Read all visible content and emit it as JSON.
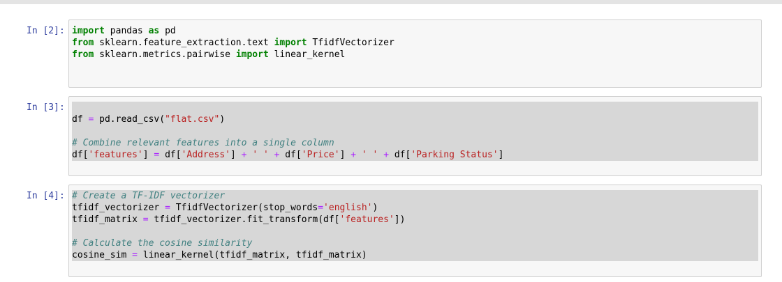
{
  "cells": [
    {
      "prompt": "In [2]:",
      "lines": [
        [
          [
            "kw",
            "import"
          ],
          [
            "t",
            " pandas "
          ],
          [
            "kw",
            "as"
          ],
          [
            "t",
            " pd"
          ]
        ],
        [
          [
            "kw",
            "from"
          ],
          [
            "t",
            " sklearn.feature_extraction.text "
          ],
          [
            "kw",
            "import"
          ],
          [
            "t",
            " TfidfVectorizer"
          ]
        ],
        [
          [
            "kw",
            "from"
          ],
          [
            "t",
            " sklearn.metrics.pairwise "
          ],
          [
            "kw",
            "import"
          ],
          [
            "t",
            " linear_kernel"
          ]
        ]
      ]
    },
    {
      "prompt": "In [3]:",
      "lines": [
        [
          [
            "t",
            "df "
          ],
          [
            "op",
            "="
          ],
          [
            "t",
            " pd.read_csv("
          ],
          [
            "str",
            "\"flat.csv\""
          ],
          [
            "t",
            ")"
          ]
        ],
        [],
        [
          [
            "cm",
            "# Combine relevant features into a single column"
          ]
        ],
        [
          [
            "t",
            "df["
          ],
          [
            "str",
            "'features'"
          ],
          [
            "t",
            "] "
          ],
          [
            "op",
            "="
          ],
          [
            "t",
            " df["
          ],
          [
            "str",
            "'Address'"
          ],
          [
            "t",
            "] "
          ],
          [
            "op",
            "+"
          ],
          [
            "t",
            " "
          ],
          [
            "str",
            "' '"
          ],
          [
            "t",
            " "
          ],
          [
            "op",
            "+"
          ],
          [
            "t",
            " df["
          ],
          [
            "str",
            "'Price'"
          ],
          [
            "t",
            "] "
          ],
          [
            "op",
            "+"
          ],
          [
            "t",
            " "
          ],
          [
            "str",
            "' '"
          ],
          [
            "t",
            " "
          ],
          [
            "op",
            "+"
          ],
          [
            "t",
            " df["
          ],
          [
            "str",
            "'Parking Status'"
          ],
          [
            "t",
            "]"
          ]
        ]
      ]
    },
    {
      "prompt": "In [4]:",
      "lines": [
        [
          [
            "cm",
            "# Create a TF-IDF vectorizer"
          ]
        ],
        [
          [
            "t",
            "tfidf_vectorizer "
          ],
          [
            "op",
            "="
          ],
          [
            "t",
            " TfidfVectorizer(stop_words"
          ],
          [
            "op",
            "="
          ],
          [
            "str",
            "'english'"
          ],
          [
            "t",
            ")"
          ]
        ],
        [
          [
            "t",
            "tfidf_matrix "
          ],
          [
            "op",
            "="
          ],
          [
            "t",
            " tfidf_vectorizer.fit_transform(df["
          ],
          [
            "str",
            "'features'"
          ],
          [
            "t",
            "])"
          ]
        ],
        [],
        [
          [
            "cm",
            "# Calculate the cosine similarity"
          ]
        ],
        [
          [
            "t",
            "cosine_sim "
          ],
          [
            "op",
            "="
          ],
          [
            "t",
            " linear_kernel(tfidf_matrix, tfidf_matrix)"
          ]
        ]
      ]
    }
  ]
}
